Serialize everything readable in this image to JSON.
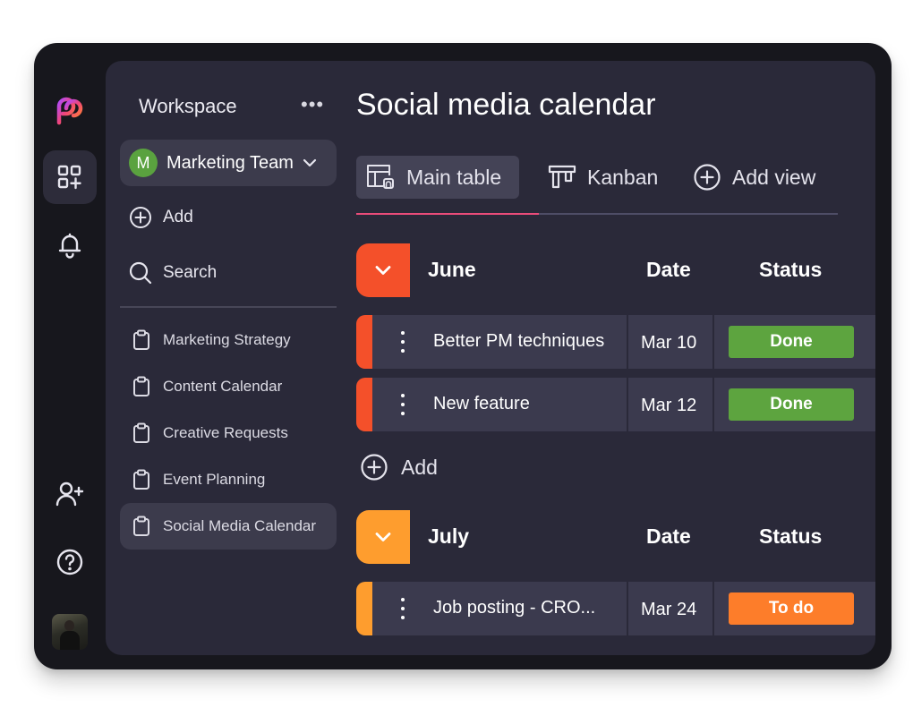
{
  "colors": {
    "accent_pink": "#ea4c7a",
    "june_group": "#f4502a",
    "july_group": "#fe9d2e",
    "status_done": "#5da43f",
    "status_todo": "#fd7d2a",
    "team_badge": "#5aa23f"
  },
  "rail": {
    "icons": [
      "logo-icon",
      "dashboard-icon",
      "bell-icon",
      "add-user-icon",
      "help-icon",
      "user-avatar"
    ]
  },
  "sidebar": {
    "workspace_label": "Workspace",
    "more_label": "•••",
    "team": {
      "badge": "M",
      "name": "Marketing Team"
    },
    "add_label": "Add",
    "search_label": "Search",
    "boards": [
      {
        "label": "Marketing Strategy"
      },
      {
        "label": "Content Calendar"
      },
      {
        "label": "Creative Requests"
      },
      {
        "label": "Event Planning"
      },
      {
        "label": "Social Media Calendar"
      }
    ]
  },
  "main": {
    "title": "Social media calendar",
    "tabs": [
      {
        "label": "Main table"
      },
      {
        "label": "Kanban"
      },
      {
        "label": "Add view"
      }
    ],
    "groups": [
      {
        "title": "June",
        "date_header": "Date",
        "status_header": "Status",
        "tasks": [
          {
            "name": "Better PM techniques",
            "date": "Mar 10",
            "status": "Done"
          },
          {
            "name": "New feature",
            "date": "Mar 12",
            "status": "Done"
          }
        ],
        "add_label": "Add"
      },
      {
        "title": "July",
        "date_header": "Date",
        "status_header": "Status",
        "tasks": [
          {
            "name": "Job posting - CRO...",
            "date": "Mar 24",
            "status": "To do"
          }
        ]
      }
    ]
  }
}
